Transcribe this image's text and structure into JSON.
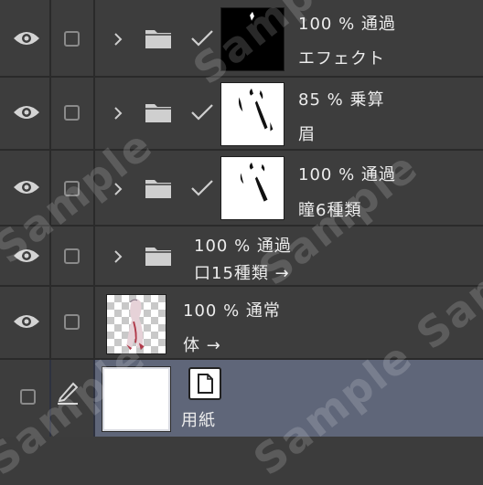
{
  "layers": [
    {
      "opacity_blend": "100 % 通過",
      "name": "エフェクト",
      "type": "folder",
      "clipped": true,
      "thumbnail": "black"
    },
    {
      "opacity_blend": "85 % 乗算",
      "name": "眉",
      "type": "folder",
      "clipped": true,
      "thumbnail": "white"
    },
    {
      "opacity_blend": "100 % 通過",
      "name": "瞳6種類",
      "type": "folder",
      "clipped": true,
      "thumbnail": "white"
    },
    {
      "opacity_blend": "100 % 通過",
      "name": "口15種類 →",
      "type": "folder",
      "clipped": false,
      "thumbnail": "none"
    },
    {
      "opacity_blend": "100 % 通常",
      "name": "体 →",
      "type": "raster",
      "clipped": false,
      "thumbnail": "checker"
    },
    {
      "name": "用紙",
      "type": "paper",
      "selected": true
    }
  ],
  "watermark_text": "Sample",
  "colors": {
    "panel_bg": "#3d3d3d",
    "selected_bg": "#5f6679",
    "divider": "#2a2a2a",
    "icon": "#cfcfcf"
  }
}
